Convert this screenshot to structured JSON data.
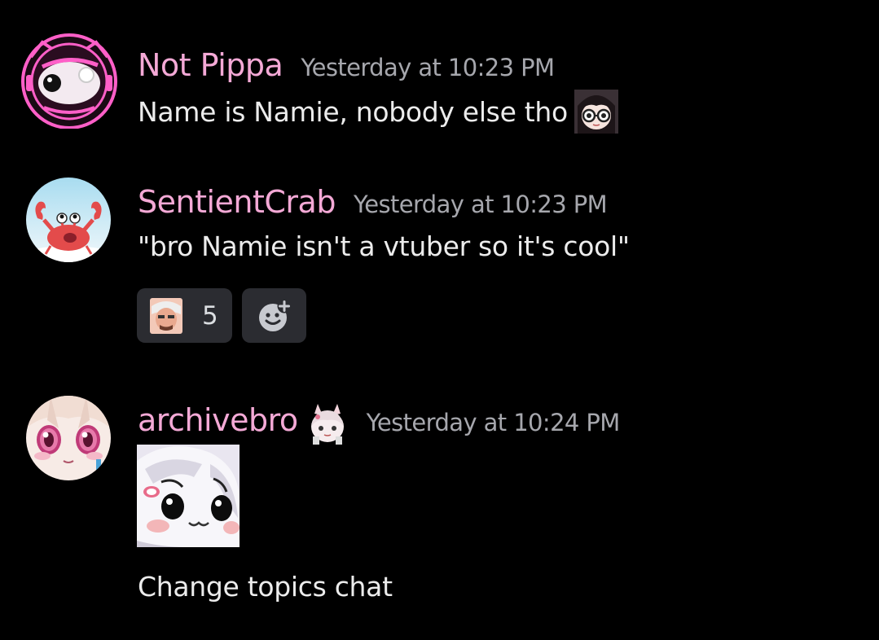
{
  "messages": [
    {
      "username": "Not Pippa",
      "timestamp": "Yesterday at 10:23 PM",
      "text": "Name is Namie, nobody else tho",
      "avatar_icon": "pink-robot-avatar",
      "inline_emoji": "anime-girl-glasses-emoji"
    },
    {
      "username": "SentientCrab",
      "timestamp": "Yesterday at 10:23 PM",
      "text": "\"bro Namie isn't a vtuber so it's cool\"",
      "avatar_icon": "red-crab-avatar",
      "reactions": [
        {
          "emoji": "face-emoji",
          "count": "5"
        }
      ],
      "add_reaction_icon": "add-reaction-icon"
    },
    {
      "username": "archivebro",
      "timestamp": "Yesterday at 10:24 PM",
      "text": "Change topics chat",
      "avatar_icon": "anime-girl-avatar",
      "badge_emoji": "white-haired-chibi-emoji",
      "sticker": "chibi-white-hair-sticker"
    }
  ],
  "colors": {
    "background": "#000000",
    "username": "#f4a9d6",
    "timestamp": "#a6a7ad",
    "text": "#ececec",
    "reaction_bg": "#2b2c31"
  }
}
